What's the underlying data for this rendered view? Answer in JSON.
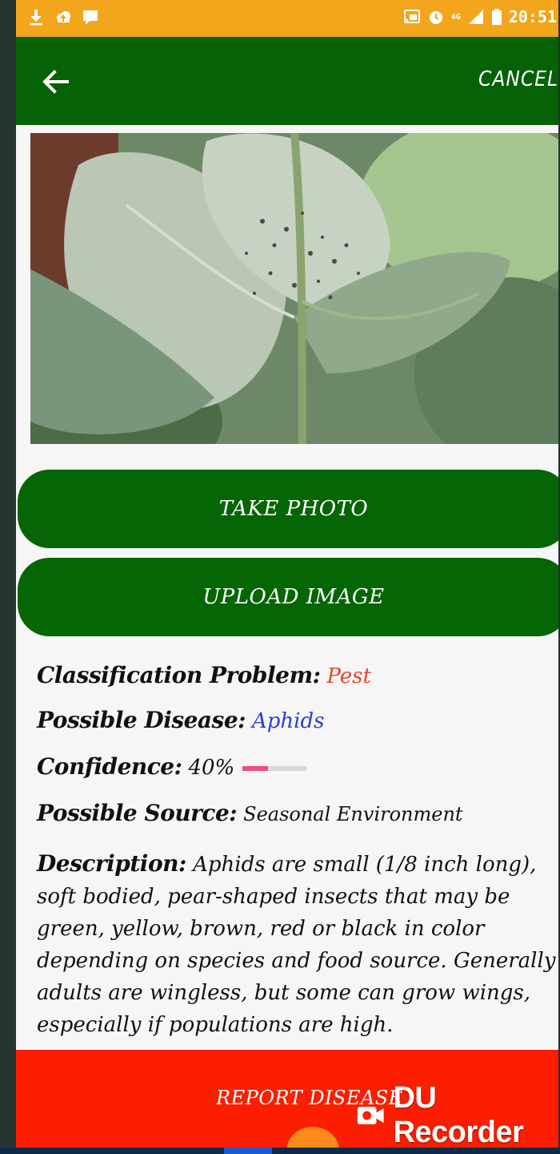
{
  "status_bar": {
    "time": "20:51",
    "network": "4G",
    "battery_level": "5",
    "left_icons": [
      "download-icon",
      "cloud-upload-icon",
      "chat-icon"
    ],
    "right_icons": [
      "cast-icon",
      "alarm-icon",
      "signal-icon",
      "battery-icon"
    ]
  },
  "app_bar": {
    "back_icon": "arrow-left-icon",
    "cancel_label": "CANCEL"
  },
  "actions": {
    "take_photo_label": "TAKE PHOTO",
    "upload_image_label": "UPLOAD IMAGE",
    "report_label": "REPORT DISEASE"
  },
  "result": {
    "classification_label": "Classification Problem:",
    "classification_value": "Pest",
    "disease_label": "Possible Disease:",
    "disease_value": "Aphids",
    "confidence_label": "Confidence:",
    "confidence_value": "40%",
    "confidence_fraction": 0.4,
    "source_label": "Possible Source:",
    "source_value": "Seasonal Environment",
    "description_label": "Description:",
    "description_value": "Aphids are small (1/8 inch long), soft bodied, pear-shaped insects that may be green, yellow, brown, red or black in color depending on species and food source. Generally adults are wingless, but some can grow wings, especially if populations are high."
  },
  "overlay": {
    "recorder_text": "DU Recorder"
  },
  "colors": {
    "status_bar": "#f3a51b",
    "app_bar": "#066207",
    "primary_button": "#046604",
    "report_button": "#fc1e00",
    "pest_value": "#e5452b",
    "disease_value": "#2b3fd1",
    "progress_fill": "#ee4c7b"
  }
}
